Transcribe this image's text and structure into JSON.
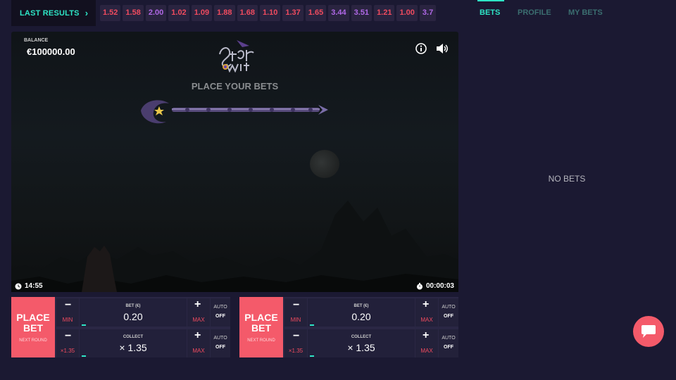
{
  "header": {
    "last_results_label": "LAST RESULTS",
    "results": [
      {
        "value": "1.52",
        "color": "red"
      },
      {
        "value": "1.58",
        "color": "red"
      },
      {
        "value": "2.00",
        "color": "purple"
      },
      {
        "value": "1.02",
        "color": "red"
      },
      {
        "value": "1.09",
        "color": "red"
      },
      {
        "value": "1.88",
        "color": "red"
      },
      {
        "value": "1.68",
        "color": "red"
      },
      {
        "value": "1.10",
        "color": "red"
      },
      {
        "value": "1.37",
        "color": "red"
      },
      {
        "value": "1.65",
        "color": "red"
      },
      {
        "value": "3.44",
        "color": "purple"
      },
      {
        "value": "3.51",
        "color": "purple"
      },
      {
        "value": "1.21",
        "color": "red"
      },
      {
        "value": "1.00",
        "color": "red"
      },
      {
        "value": "3.7",
        "color": "purple"
      }
    ]
  },
  "game": {
    "balance_label": "BALANCE",
    "balance_value": "€100000.00",
    "status": "PLACE YOUR BETS",
    "clock": "14:55",
    "timer": "00:00:03"
  },
  "panels": [
    {
      "place_bet_label": "PLACE BET",
      "next_round_label": "NEXT ROUND",
      "bet_label": "BET (€)",
      "bet_value": "0.20",
      "min_label": "MIN",
      "max_label": "MAX",
      "collect_label": "COLLECT",
      "collect_value": "× 1.35",
      "collect_min_label": "×1.35",
      "collect_max_label": "MAX",
      "auto_label": "AUTO",
      "auto_value": "OFF",
      "minus": "−",
      "plus": "+"
    },
    {
      "place_bet_label": "PLACE BET",
      "next_round_label": "NEXT ROUND",
      "bet_label": "BET (€)",
      "bet_value": "0.20",
      "min_label": "MIN",
      "max_label": "MAX",
      "collect_label": "COLLECT",
      "collect_value": "× 1.35",
      "collect_min_label": "×1.35",
      "collect_max_label": "MAX",
      "auto_label": "AUTO",
      "auto_value": "OFF",
      "minus": "−",
      "plus": "+"
    }
  ],
  "sidebar": {
    "tabs": [
      "BETS",
      "PROFILE",
      "MY BETS"
    ],
    "active_tab": "BETS",
    "empty_text": "NO BETS"
  },
  "colors": {
    "accent": "#2ee5c6",
    "place_bet": "#f45a6a",
    "result_red": "#f04b5f",
    "result_purple": "#b068e6",
    "background": "#1b1932"
  },
  "icons": [
    "chevron-right-icon",
    "info-icon",
    "sound-icon",
    "clock-icon",
    "stopwatch-icon",
    "chat-icon"
  ]
}
